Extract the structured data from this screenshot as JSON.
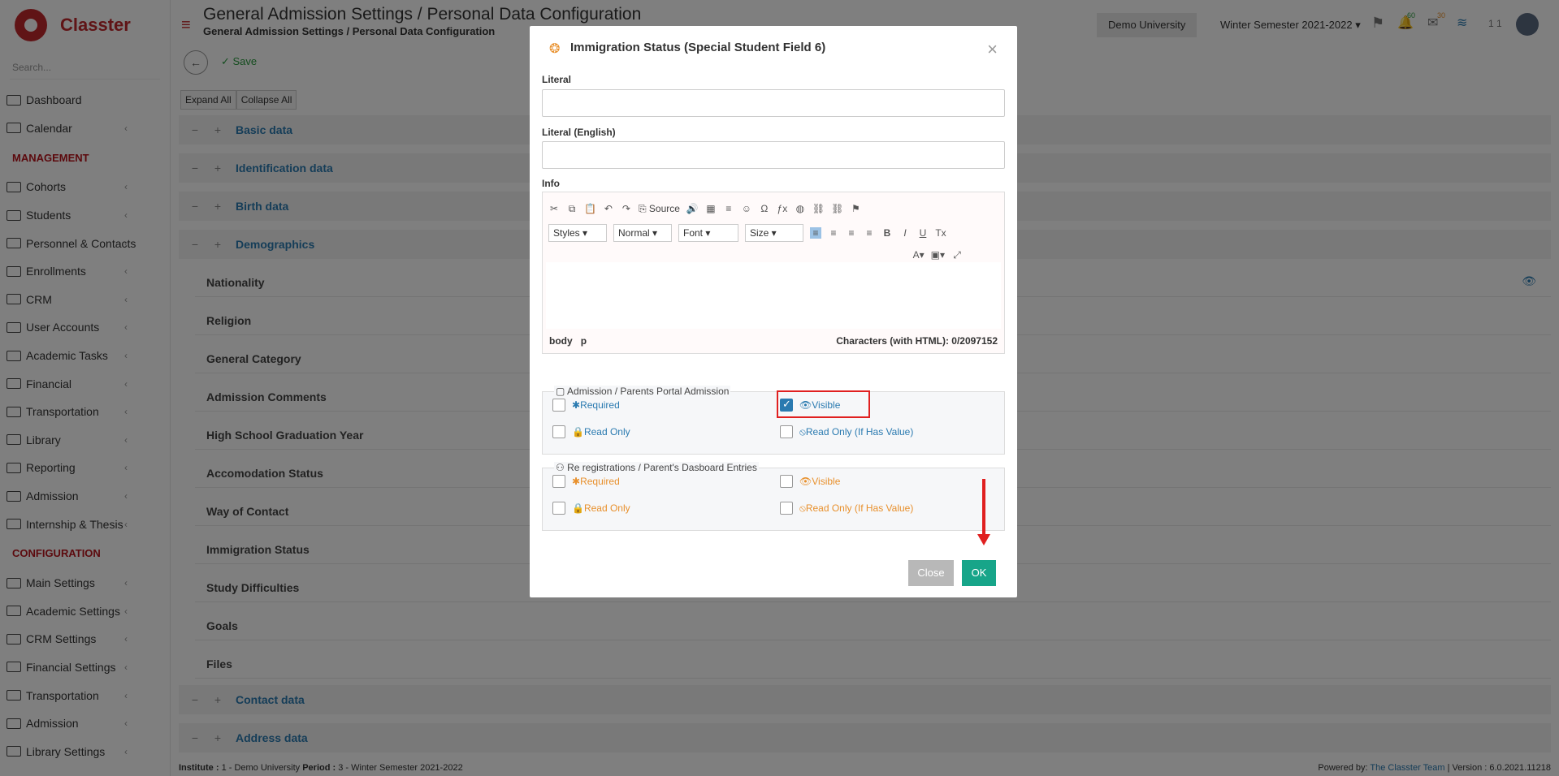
{
  "brand": {
    "name": "Classter"
  },
  "search": {
    "placeholder": "Search..."
  },
  "sidebar": {
    "items_top": [
      {
        "label": "Dashboard",
        "chevron": false
      },
      {
        "label": "Calendar",
        "chevron": true
      }
    ],
    "management_heading": "MANAGEMENT",
    "management": [
      {
        "label": "Cohorts"
      },
      {
        "label": "Students"
      },
      {
        "label": "Personnel & Contacts"
      },
      {
        "label": "Enrollments"
      },
      {
        "label": "CRM"
      },
      {
        "label": "User Accounts"
      },
      {
        "label": "Academic Tasks"
      },
      {
        "label": "Financial"
      },
      {
        "label": "Transportation"
      },
      {
        "label": "Library"
      },
      {
        "label": "Reporting"
      },
      {
        "label": "Admission"
      },
      {
        "label": "Internship & Thesis"
      }
    ],
    "configuration_heading": "CONFIGURATION",
    "configuration": [
      {
        "label": "Main Settings"
      },
      {
        "label": "Academic Settings"
      },
      {
        "label": "CRM Settings"
      },
      {
        "label": "Financial Settings"
      },
      {
        "label": "Transportation"
      },
      {
        "label": "Admission"
      },
      {
        "label": "Library Settings"
      }
    ]
  },
  "header": {
    "title": "General Admission Settings / Personal Data Configuration",
    "subtitle": "General Admission Settings / Personal Data Configuration",
    "institution": "Demo University",
    "period": "Winter Semester 2021-2022",
    "notif_count": "60",
    "mail_count": "30",
    "user_code": "1 1"
  },
  "toolbar": {
    "save_label": "Save",
    "expand_all": "Expand All",
    "collapse_all": "Collapse All"
  },
  "sections": {
    "basic": "Basic data",
    "identification": "Identification data",
    "birth": "Birth data",
    "demographics": "Demographics",
    "contact": "Contact data",
    "address": "Address data"
  },
  "demographic_fields": [
    "Nationality",
    "Religion",
    "General Category",
    "Admission Comments",
    "High School Graduation Year",
    "Accomodation Status",
    "Way of Contact",
    "Immigration Status",
    "Study Difficulties",
    "Goals",
    "Files"
  ],
  "footer": {
    "institute_label": "Institute :",
    "institute_value": "1 - Demo University",
    "period_label": "Period :",
    "period_value": "3 - Winter Semester 2021-2022",
    "powered": "Powered by:",
    "team": "The Classter Team",
    "version": "| Version : 6.0.2021.11218"
  },
  "modal": {
    "title": "Immigration Status (Special Student Field 6)",
    "literal_label": "Literal",
    "literal_value": "",
    "literal_en_label": "Literal (English)",
    "literal_en_value": "",
    "info_label": "Info",
    "editor": {
      "source_label": "Source",
      "styles": "Styles",
      "format": "Normal",
      "font": "Font",
      "size": "Size",
      "path_body": "body",
      "path_p": "p",
      "chars": "Characters (with HTML): 0/2097152"
    },
    "group1": {
      "title": "Admission / Parents Portal Admission",
      "required": "Required",
      "visible": "Visible",
      "read_only": "Read Only",
      "read_only_if": "Read Only (If Has Value)",
      "visible_checked": true
    },
    "group2": {
      "title": "Re registrations / Parent's Dasboard Entries",
      "required": "Required",
      "visible": "Visible",
      "read_only": "Read Only",
      "read_only_if": "Read Only (If Has Value)"
    },
    "close_label": "Close",
    "ok_label": "OK"
  },
  "colors": {
    "brand": "#c0282d",
    "link": "#2a7ab0",
    "ok": "#17a589",
    "annotation": "#e02020"
  }
}
